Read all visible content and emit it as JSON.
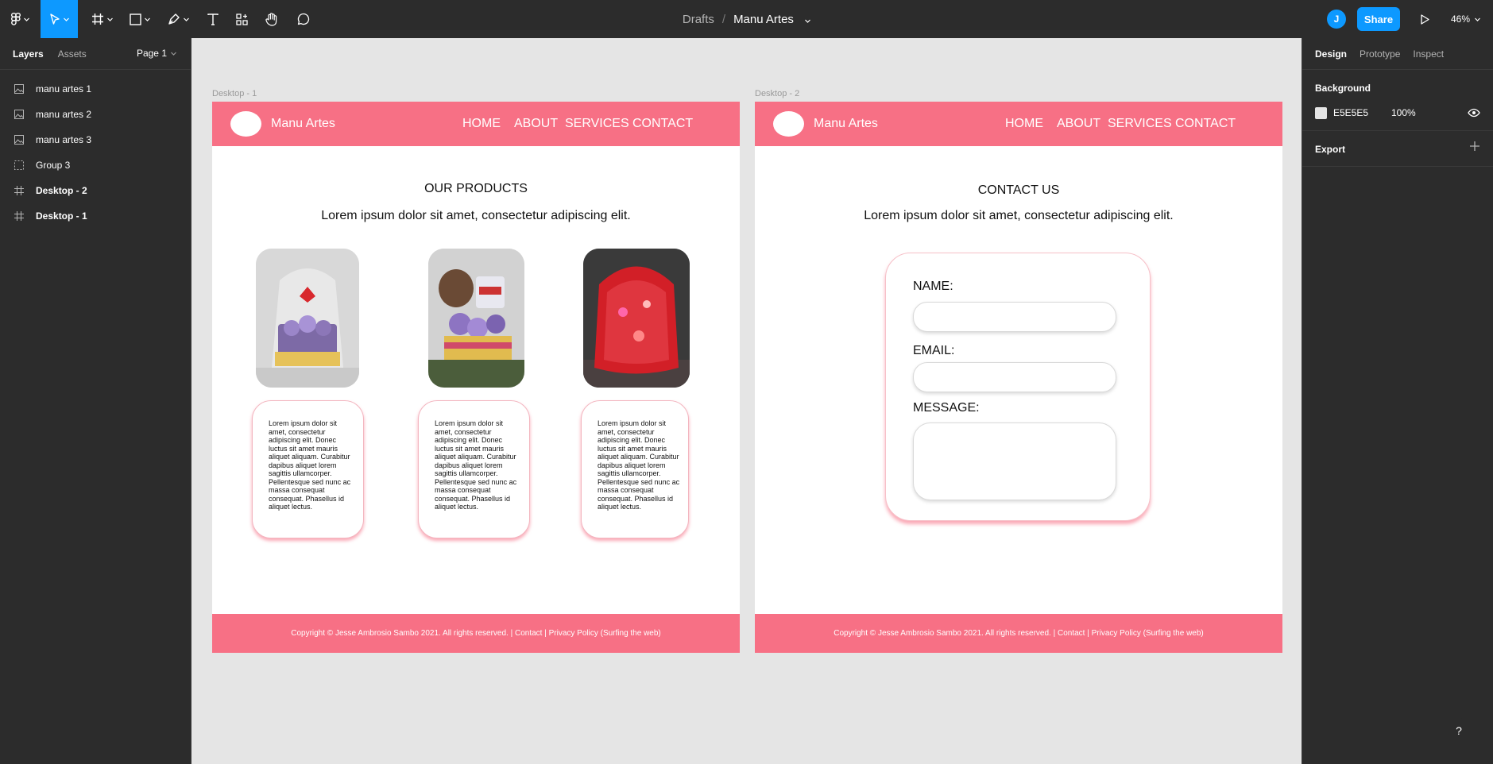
{
  "toolbar": {
    "breadcrumb_parent": "Drafts",
    "breadcrumb_separator": "/",
    "file_name": "Manu Artes",
    "avatar_initial": "J",
    "share_label": "Share",
    "zoom_level": "46%",
    "accent_color": "#0d99ff"
  },
  "left_panel": {
    "tabs": [
      "Layers",
      "Assets"
    ],
    "page_label": "Page 1",
    "layers": [
      {
        "name": "manu artes 1",
        "icon": "image-icon"
      },
      {
        "name": "manu artes 2",
        "icon": "image-icon"
      },
      {
        "name": "manu artes 3",
        "icon": "image-icon"
      },
      {
        "name": "Group 3",
        "icon": "group-icon"
      },
      {
        "name": "Desktop - 2",
        "icon": "frame-icon"
      },
      {
        "name": "Desktop - 1",
        "icon": "frame-icon"
      }
    ]
  },
  "right_panel": {
    "tabs": [
      "Design",
      "Prototype",
      "Inspect"
    ],
    "background_title": "Background",
    "background_hex": "E5E5E5",
    "background_opacity": "100%",
    "export_title": "Export"
  },
  "canvas": {
    "background_color": "#e5e5e5",
    "site_pink": "#f77085",
    "frame1": {
      "label": "Desktop - 1",
      "brand": "Manu Artes",
      "nav": [
        "HOME",
        "ABOUT",
        "SERVICES",
        "CONTACT"
      ],
      "title": "OUR PRODUCTS",
      "subtitle": "Lorem ipsum dolor sit amet, consectetur adipiscing elit.",
      "products": [
        {
          "image": "gift basket with purple flowers wrapped in cellophane with red bow",
          "text": "Lorem ipsum dolor sit amet, consectetur adipiscing elit. Donec luctus sit amet mauris aliquet aliquam. Curabitur dapibus aliquet lorem sagittis ullamcorper. Pellentesque sed nunc ac massa consequat consequat. Phasellus id aliquet lectus."
        },
        {
          "image": "gift basket with plush moose, mug and purple flowers",
          "text": "Lorem ipsum dolor sit amet, consectetur adipiscing elit. Donec luctus sit amet mauris aliquet aliquam. Curabitur dapibus aliquet lorem sagittis ullamcorper. Pellentesque sed nunc ac massa consequat consequat. Phasellus id aliquet lectus."
        },
        {
          "image": "gift basket wrapped in red patterned cellophane",
          "text": "Lorem ipsum dolor sit amet, consectetur adipiscing elit. Donec luctus sit amet mauris aliquet aliquam. Curabitur dapibus aliquet lorem sagittis ullamcorper. Pellentesque sed nunc ac massa consequat consequat. Phasellus id aliquet lectus."
        }
      ],
      "footer": "Copyright © Jesse Ambrosio Sambo 2021. All rights reserved. | Contact | Privacy Policy (Surfing the web)"
    },
    "frame2": {
      "label": "Desktop - 2",
      "brand": "Manu Artes",
      "nav": [
        "HOME",
        "ABOUT",
        "SERVICES",
        "CONTACT"
      ],
      "title": "CONTACT US",
      "subtitle": "Lorem ipsum dolor sit amet, consectetur adipiscing elit.",
      "form": {
        "name_label": "NAME:",
        "email_label": "EMAIL:",
        "message_label": "MESSAGE:"
      },
      "footer": "Copyright © Jesse Ambrosio Sambo 2021. All rights reserved. | Contact | Privacy Policy (Surfing the web)"
    }
  },
  "help_label": "?"
}
